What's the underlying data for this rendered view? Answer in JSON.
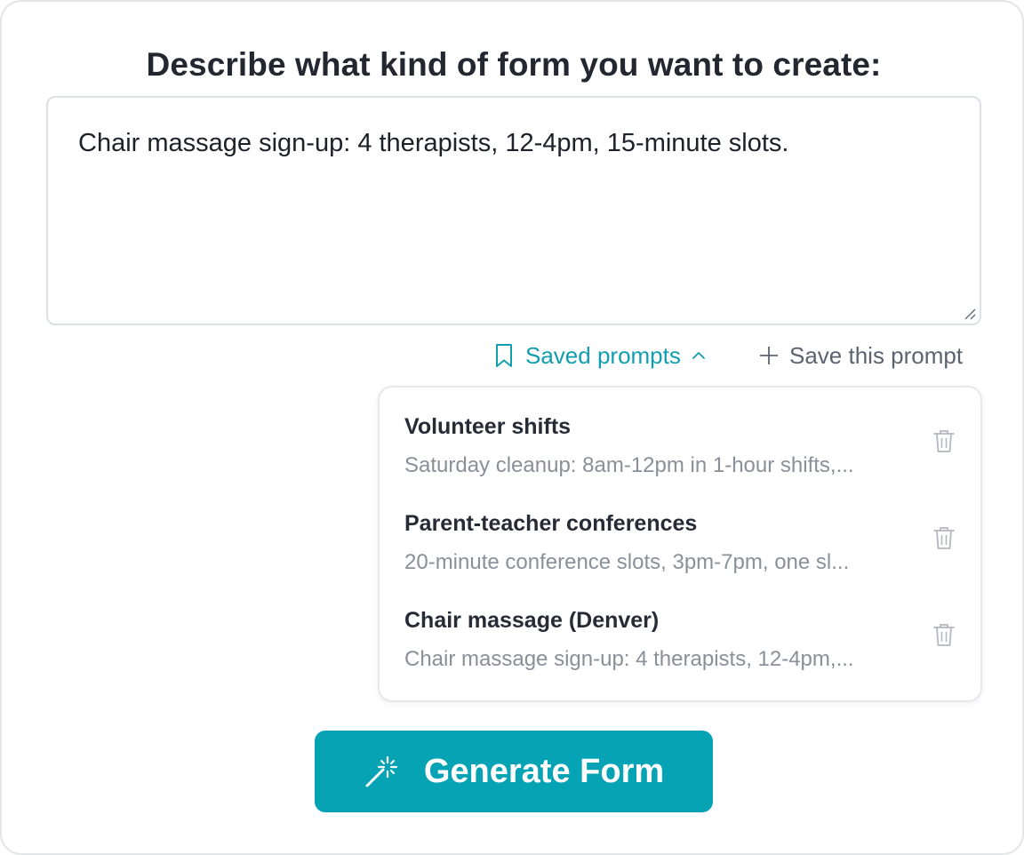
{
  "header": {
    "title": "Describe what kind of form you want to create:"
  },
  "prompt": {
    "value": "Chair massage sign-up: 4 therapists, 12-4pm, 15-minute slots."
  },
  "toolbar": {
    "saved_prompts_label": "Saved prompts",
    "save_prompt_label": "Save this prompt"
  },
  "saved_prompts": {
    "items": [
      {
        "title": "Volunteer shifts",
        "description": "Saturday cleanup: 8am-12pm in 1-hour shifts,..."
      },
      {
        "title": "Parent-teacher conferences",
        "description": "20-minute conference slots, 3pm-7pm, one sl..."
      },
      {
        "title": "Chair massage (Denver)",
        "description": "Chair massage sign-up: 4 therapists, 12-4pm,..."
      }
    ]
  },
  "actions": {
    "generate_label": "Generate Form"
  },
  "colors": {
    "accent": "#06a3b5",
    "link_accent": "#119fb0",
    "muted_text": "#8a9099",
    "border": "#e3e5e8"
  },
  "icons": {
    "saved_prompts": "bookmark-icon",
    "saved_prompts_toggle": "chevron-up-icon",
    "save_prompt": "plus-icon",
    "delete": "trash-icon",
    "generate": "magic-wand-icon"
  }
}
